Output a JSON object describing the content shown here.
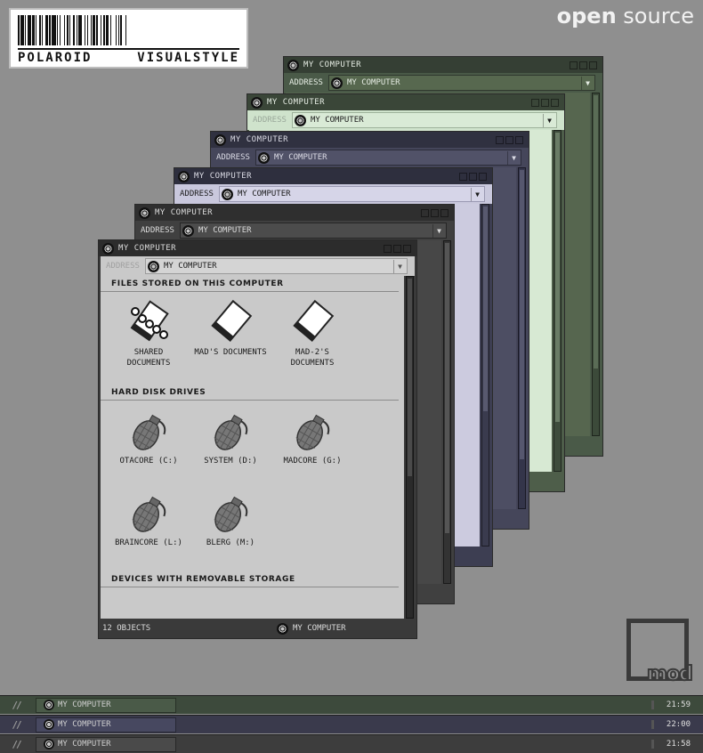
{
  "logo": {
    "text_left": "POLAROID",
    "text_right": "VISUALSTYLE"
  },
  "brand": {
    "bold": "open",
    "light": "source"
  },
  "windows": [
    {
      "title": "MY COMPUTER",
      "address_label": "ADDRESS",
      "address_value": "MY COMPUTER",
      "theme": "green"
    },
    {
      "title": "MY COMPUTER",
      "address_label": "ADDRESS",
      "address_value": "MY COMPUTER",
      "theme": "mint"
    },
    {
      "title": "MY COMPUTER",
      "address_label": "ADDRESS",
      "address_value": "MY COMPUTER",
      "theme": "navy"
    },
    {
      "title": "MY COMPUTER",
      "address_label": "ADDRESS",
      "address_value": "MY COMPUTER",
      "theme": "lilac"
    },
    {
      "title": "MY COMPUTER",
      "address_label": "ADDRESS",
      "address_value": "MY COMPUTER",
      "theme": "dark"
    },
    {
      "title": "MY COMPUTER",
      "address_label": "ADDRESS",
      "address_value": "MY COMPUTER",
      "theme": "grey"
    }
  ],
  "front": {
    "section_files": "FILES STORED ON THIS COMPUTER",
    "section_drives": "HARD DISK DRIVES",
    "section_removable": "DEVICES WITH REMOVABLE STORAGE",
    "files": [
      {
        "label_1": "SHARED",
        "label_2": "DOCUMENTS",
        "icon": "shared-folder-icon"
      },
      {
        "label_1": "MAD'S DOCUMENTS",
        "label_2": "",
        "icon": "document-folder-icon"
      },
      {
        "label_1": "MAD-2'S",
        "label_2": "DOCUMENTS",
        "icon": "document-folder-icon"
      }
    ],
    "drives": [
      {
        "label": "OTACORE (C:)",
        "icon": "grenade-drive-icon"
      },
      {
        "label": "SYSTEM (D:)",
        "icon": "grenade-drive-icon"
      },
      {
        "label": "MADCORE (G:)",
        "icon": "grenade-drive-icon"
      },
      {
        "label": "BRAINCORE (L:)",
        "icon": "grenade-drive-icon"
      },
      {
        "label": "BLERG (M:)",
        "icon": "grenade-drive-icon"
      }
    ],
    "status_count": "12 OBJECTS",
    "status_location": "MY COMPUTER"
  },
  "taskbars": [
    {
      "button": "MY COMPUTER",
      "time": "21:59",
      "color": "#3d4a3c"
    },
    {
      "button": "MY COMPUTER",
      "time": "22:00",
      "color": "#3a3a4c"
    },
    {
      "button": "MY COMPUTER",
      "time": "21:58",
      "color": "#3d3d3d"
    }
  ],
  "mod_logo": "mod",
  "colors": {
    "desktop": "#8f8f8f",
    "green": "#4a5a48",
    "mint": "#cfe3cc",
    "navy": "#45465a",
    "lilac": "#c9c8dd",
    "dark": "#404040",
    "grey_front": "#c9c9c9"
  }
}
